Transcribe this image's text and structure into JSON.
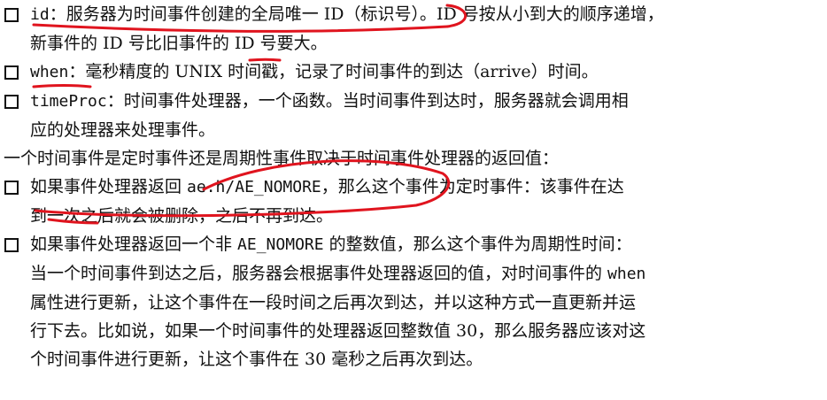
{
  "items": [
    {
      "code": "id",
      "lines": [
        "：服务器为时间事件创建的全局唯一 ID（标识号）。ID 号按从小到大的顺序递增，",
        "新事件的 ID 号比旧事件的 ID 号要大。"
      ]
    },
    {
      "code": "when",
      "lines": [
        "：毫秒精度的 UNIX 时间戳，记录了时间事件的到达（arrive）时间。"
      ]
    },
    {
      "code": "timeProc",
      "lines": [
        "：时间事件处理器，一个函数。当时间事件到达时，服务器就会调用相",
        "应的处理器来处理事件。"
      ]
    }
  ],
  "paragraph": "一个时间事件是定时事件还是周期性事件取决于时间事件处理器的返回值：",
  "cases": [
    {
      "pre": "如果事件处理器返回 ",
      "code": "ae.h/AE_NOMORE",
      "post": "，那么这个事件为定时事件：该事件在达",
      "lines": [
        "到一次之后就会被删除，之后不再到达。"
      ]
    },
    {
      "pre": "如果事件处理器返回一个非 ",
      "code": "AE_NOMORE",
      "post": " 的整数值，那么这个事件为周期性时间：",
      "line2_pre": "当一个时间事件到达之后，服务器会根据事件处理器返回的值，对时间事件的 ",
      "line2_code": "when",
      "lines": [
        "属性进行更新，让这个事件在一段时间之后再次到达，并以这种方式一直更新并运",
        "行下去。比如说，如果一个时间事件的处理器返回整数值 30，那么服务器应该对这",
        "个时间事件进行更新，让这个事件在 30 毫秒之后再次到达。"
      ]
    }
  ]
}
